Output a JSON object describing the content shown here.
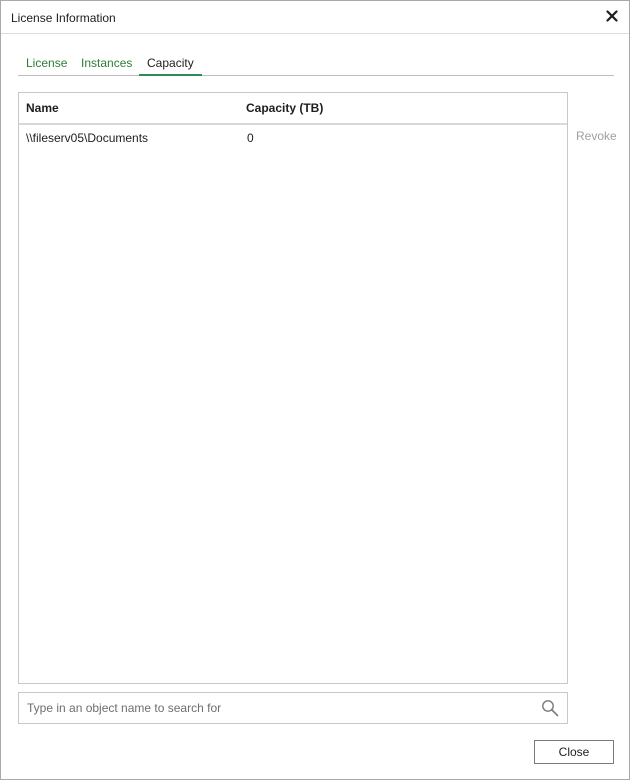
{
  "window": {
    "title": "License Information",
    "close_icon": "close-icon"
  },
  "tabs": [
    {
      "label": "License",
      "active": false
    },
    {
      "label": "Instances",
      "active": false
    },
    {
      "label": "Capacity",
      "active": true
    }
  ],
  "table": {
    "columns": [
      "Name",
      "Capacity (TB)"
    ],
    "rows": [
      {
        "name": "\\\\fileserv05\\Documents",
        "capacity": "0"
      }
    ]
  },
  "actions": {
    "revoke_label": "Revoke"
  },
  "search": {
    "placeholder": "Type in an object name to search for",
    "value": "",
    "icon": "search-icon"
  },
  "footer": {
    "close_label": "Close"
  },
  "colors": {
    "tab_text": "#2e7d32",
    "tab_underline": "#2e8b57",
    "disabled_text": "#a0a0a0"
  }
}
